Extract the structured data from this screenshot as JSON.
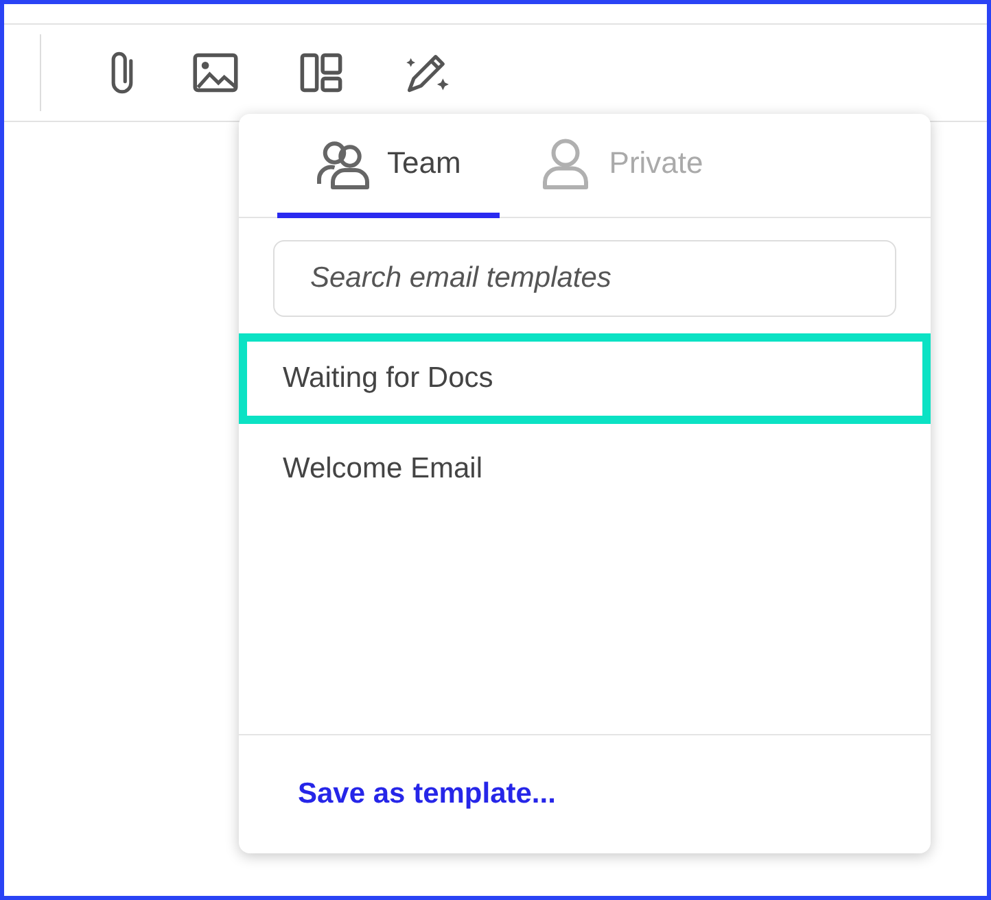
{
  "toolbar": {
    "buttons": [
      {
        "kind": "attach"
      },
      {
        "kind": "image"
      },
      {
        "kind": "layout"
      },
      {
        "kind": "magic"
      }
    ]
  },
  "templates_popup": {
    "tabs": [
      {
        "label": "Team",
        "kind": "team",
        "selected": true
      },
      {
        "label": "Private",
        "kind": "private",
        "selected": false
      }
    ],
    "search": {
      "placeholder": "Search email templates"
    },
    "items": [
      {
        "label": "Waiting for Docs",
        "selected": true
      },
      {
        "label": "Welcome Email",
        "selected": false
      }
    ],
    "footer_link": "Save as template..."
  }
}
